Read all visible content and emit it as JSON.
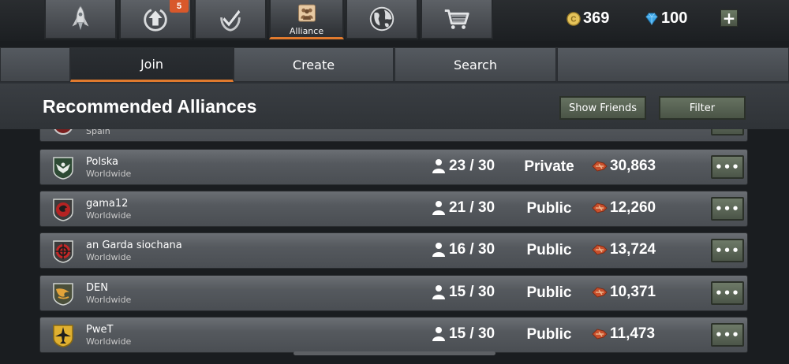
{
  "nav": {
    "alliance_label": "Alliance",
    "upgrade_badge": "5",
    "icons": [
      "rocket-icon",
      "upgrade-icon",
      "medal-icon",
      "alliance-icon",
      "globe-icon",
      "cart-icon"
    ]
  },
  "currency": {
    "coins": "369",
    "gems": "100"
  },
  "tabs": [
    {
      "label": "Join"
    },
    {
      "label": "Create"
    },
    {
      "label": "Search"
    }
  ],
  "header": {
    "title": "Recommended Alliances",
    "show_friends": "Show Friends",
    "filter": "Filter"
  },
  "more_label": "•••",
  "partial_row": {
    "region": "Spain"
  },
  "alliances": [
    {
      "name": "Polska",
      "region": "Worldwide",
      "members": "23 / 30",
      "privacy": "Private",
      "power": "30,863",
      "emblem": "eagle-emblem-icon"
    },
    {
      "name": "gama12",
      "region": "Worldwide",
      "members": "21 / 30",
      "privacy": "Public",
      "power": "12,260",
      "emblem": "dragon-emblem-icon"
    },
    {
      "name": "an Garda siochana",
      "region": "Worldwide",
      "members": "16 / 30",
      "privacy": "Public",
      "power": "13,724",
      "emblem": "crosshair-emblem-icon"
    },
    {
      "name": "DEN",
      "region": "Worldwide",
      "members": "15 / 30",
      "privacy": "Public",
      "power": "10,371",
      "emblem": "bird-emblem-icon"
    },
    {
      "name": "PweT",
      "region": "Worldwide",
      "members": "15 / 30",
      "privacy": "Public",
      "power": "11,473",
      "emblem": "jet-emblem-icon"
    }
  ],
  "colors": {
    "accent": "#e07a2e",
    "button_green": "#5b6755",
    "badge": "#d8582b"
  }
}
